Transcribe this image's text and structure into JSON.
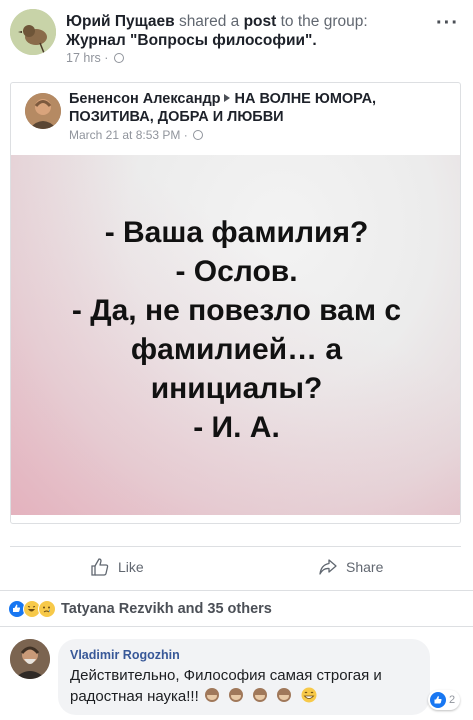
{
  "post": {
    "author": "Юрий Пущаев",
    "action_text": "shared a",
    "post_word": "post",
    "to_text": "to the group:",
    "group_name": "Журнал \"Вопросы философии\".",
    "time": "17 hrs ·",
    "more_label": "···"
  },
  "shared": {
    "author": "Бененсон Александр",
    "group": "НА ВОЛНЕ ЮМОРА, ПОЗИТИВА, ДОБРА И ЛЮБВИ",
    "time": "March 21 at 8:53 PM ·"
  },
  "meme": {
    "lines": [
      "- Ваша фамилия?",
      "- Ослов.",
      "- Да, не повезло вам с",
      "фамилией… а",
      "инициалы?",
      "- И. А."
    ]
  },
  "actions": {
    "like_label": "Like",
    "share_label": "Share"
  },
  "reactions": {
    "summary": "Tatyana Rezvikh and 35 others"
  },
  "comment": {
    "author": "Vladimir Rogozhin",
    "text": "Действительно, Философия самая строгая и радостная наука!!!",
    "reaction_count": "2"
  },
  "colors": {
    "facebook_blue": "#385898",
    "like_blue": "#1877f2",
    "meta_gray": "#90949c"
  }
}
